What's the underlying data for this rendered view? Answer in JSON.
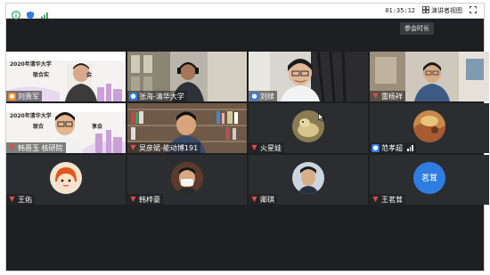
{
  "topbar": {
    "time": "01:35:12",
    "presenter_view_label": "演讲者视图"
  },
  "tooltip": "参会时长",
  "tiles": [
    {
      "name": "刘贵军",
      "badge": "host",
      "slide_text": [
        "2020年清华大学",
        "联合实",
        "会"
      ],
      "scene": "slide-person"
    },
    {
      "name": "张海-清华大学",
      "badge": "user",
      "scene": "room-headset"
    },
    {
      "name": "刘续",
      "badge": "user",
      "scene": "person-curtain"
    },
    {
      "name": "雷杨祥",
      "badge": "mute",
      "scene": "person-room"
    },
    {
      "name": "韩晋玉 核研院",
      "badge": "mute",
      "slide_text": [
        "2020年清华大学",
        "联合",
        "享会"
      ],
      "scene": "slide-person2"
    },
    {
      "name": "吴彦斌-能动博191",
      "badge": "mute",
      "scene": "bookshelf-person"
    },
    {
      "name": "火星娃",
      "badge": "mute",
      "scene": "avatar-dog"
    },
    {
      "name": "范孝超",
      "badge": "user",
      "signal": true,
      "scene": "avatar-painting"
    },
    {
      "name": "王佑",
      "badge": "mute",
      "scene": "avatar-cartoon"
    },
    {
      "name": "韩梓豪",
      "badge": "mute",
      "scene": "avatar-mask"
    },
    {
      "name": "卿琪",
      "badge": "mute",
      "scene": "avatar-selfie"
    },
    {
      "name": "王茗茸",
      "badge": "mute",
      "text_avatar": "茗茸",
      "scene": "text-avatar"
    }
  ],
  "colors": {
    "background": "#1e1f22",
    "tile": "#2b2d31",
    "host_badge": "#f08a1e",
    "user_badge": "#2f7de1",
    "mute": "#e24b4b"
  }
}
